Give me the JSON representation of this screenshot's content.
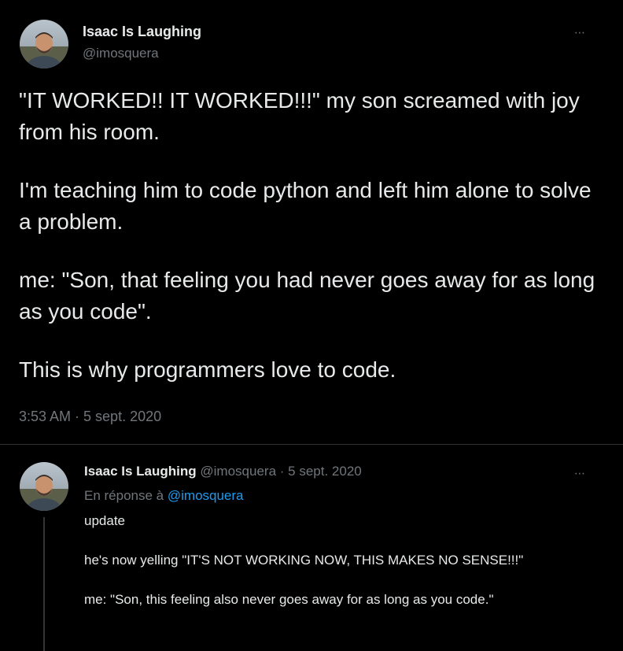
{
  "main_tweet": {
    "author_name": "Isaac Is Laughing",
    "author_handle": "@imosquera",
    "more_icon": "⋯",
    "paragraphs": [
      "\"IT WORKED!! IT WORKED!!!\" my son screamed with joy from his room.",
      "I'm teaching him to code python and left him alone to solve a problem.",
      "me: \"Son, that feeling you had never goes away for as long as you code\".",
      "This is why programmers love to code."
    ],
    "timestamp": "3:53 AM · 5 sept. 2020"
  },
  "reply_tweet": {
    "author_name": "Isaac Is Laughing",
    "author_handle": "@imosquera",
    "date": "· 5 sept. 2020",
    "more_icon": "⋯",
    "replying_prefix": "En réponse à",
    "replying_mention": "@imosquera",
    "paragraphs": [
      "update",
      "he's now yelling \"IT'S NOT WORKING NOW, THIS MAKES NO SENSE!!!\"",
      "me: \"Son, this feeling also never goes away for as long as you code.\""
    ]
  },
  "icons": {
    "avatar": "avatar-photo",
    "more": "more-options-icon"
  },
  "colors": {
    "background": "#000000",
    "text": "#e7e9ea",
    "secondary": "#71767b",
    "link": "#1d9bf0",
    "divider": "#2f3336"
  }
}
